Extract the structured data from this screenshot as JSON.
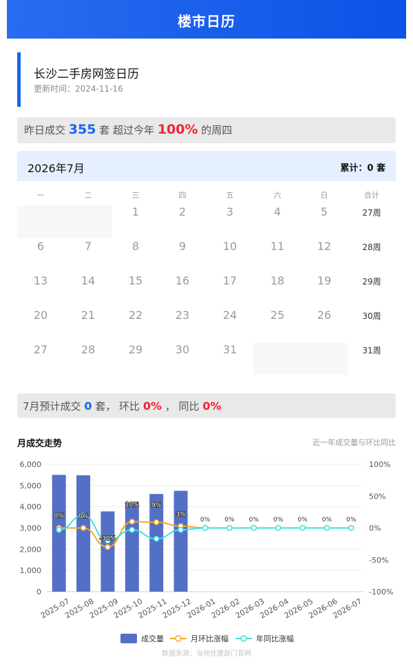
{
  "header": {
    "title": "楼市日历"
  },
  "page": {
    "title": "长沙二手房网签日历",
    "update_label": "更新时间：",
    "update_date": "2024-11-16"
  },
  "summary": {
    "prefix": "昨日成交",
    "count": "355",
    "unit": "套 超过今年",
    "percent": "100%",
    "suffix": "的周四"
  },
  "calendar": {
    "month_label": "2026年7月",
    "total_label": "累计：",
    "total_value": "0",
    "total_unit": "套",
    "weekdays": [
      "一",
      "二",
      "三",
      "四",
      "五",
      "六",
      "日",
      "合计"
    ],
    "rows": [
      {
        "days": [
          "",
          "",
          "1",
          "2",
          "3",
          "4",
          "5"
        ],
        "week": "27周"
      },
      {
        "days": [
          "6",
          "7",
          "8",
          "9",
          "10",
          "11",
          "12"
        ],
        "week": "28周"
      },
      {
        "days": [
          "13",
          "14",
          "15",
          "16",
          "17",
          "18",
          "19"
        ],
        "week": "29周"
      },
      {
        "days": [
          "20",
          "21",
          "22",
          "23",
          "24",
          "25",
          "26"
        ],
        "week": "30周"
      },
      {
        "days": [
          "27",
          "28",
          "29",
          "30",
          "31",
          "",
          ""
        ],
        "week": "31周"
      }
    ]
  },
  "forecast": {
    "prefix": "7月预计成交",
    "count": "0",
    "unit": "套，  环比",
    "mom": "0%",
    "sep": "，  同比",
    "yoy": "0%"
  },
  "trend": {
    "title": "月成交走势",
    "subtitle": "近一年成交量与环比同比"
  },
  "chart_data": {
    "type": "bar",
    "categories": [
      "2025-07",
      "2025-08",
      "2025-09",
      "2025-10",
      "2025-11",
      "2025-12",
      "2026-01",
      "2026-02",
      "2026-03",
      "2026-04",
      "2026-05",
      "2026-06",
      "2026-07"
    ],
    "series": [
      {
        "name": "成交量",
        "type": "bar",
        "axis": "left",
        "values": [
          5500,
          5480,
          3780,
          4200,
          4600,
          4750,
          0,
          0,
          0,
          0,
          0,
          0,
          0
        ]
      },
      {
        "name": "月环比涨幅",
        "type": "line",
        "axis": "right",
        "values": [
          0,
          0,
          -30,
          10,
          9,
          3,
          0,
          0,
          0,
          0,
          0,
          0,
          0
        ]
      },
      {
        "name": "年同比涨幅",
        "type": "line",
        "axis": "right",
        "values": [
          -3,
          20,
          -20,
          -3,
          -17,
          -3,
          0,
          0,
          0,
          0,
          0,
          0,
          0
        ]
      }
    ],
    "data_labels": [
      "0%",
      "0%",
      "-30%",
      "10%",
      "9%",
      "3%",
      "0%",
      "0%",
      "0%",
      "0%",
      "0%",
      "0%",
      "0%"
    ],
    "y_left_ticks": [
      "6,000",
      "5,000",
      "4,000",
      "3,000",
      "2,000",
      "1,000",
      "0"
    ],
    "y_right_ticks": [
      "100%",
      "50%",
      "0%",
      "-50%",
      "-100%"
    ],
    "ylim_left": [
      0,
      6000
    ],
    "ylim_right": [
      -100,
      100
    ],
    "legend_position": "bottom",
    "grid": true,
    "colors": {
      "bar": "#5470c6",
      "mom": "#f5a623",
      "yoy": "#39e1e6"
    }
  },
  "footer": {
    "source": "数据来源：当地住建部门官网"
  }
}
